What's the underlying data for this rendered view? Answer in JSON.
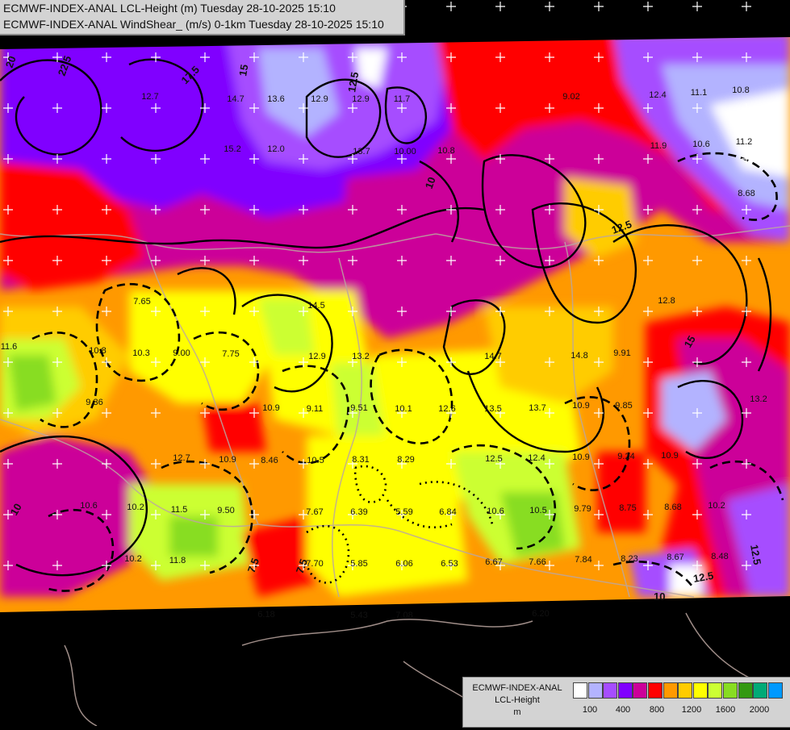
{
  "header": {
    "line1": "ECMWF-INDEX-ANAL LCL-Height (m) Tuesday 28-10-2025 15:10",
    "line2": "ECMWF-INDEX-ANAL WindShear_ (m/s) 0-1km Tuesday 28-10-2025 15:10"
  },
  "legend": {
    "title_line1": "ECMWF-INDEX-ANAL",
    "title_line2": "LCL-Height",
    "unit": "m",
    "colors": [
      "#ffffff",
      "#b3b3ff",
      "#a64dff",
      "#8000ff",
      "#cc0099",
      "#ff0000",
      "#ff9900",
      "#ffcc00",
      "#ffff00",
      "#ccff33",
      "#88dd22",
      "#339911",
      "#00aa77",
      "#0099ff"
    ],
    "ticks": [
      "100",
      "400",
      "800",
      "1200",
      "1600",
      "2000"
    ]
  },
  "map": {
    "value_labels": [
      {
        "t": "12.7"
      },
      {
        "t": "13.6"
      },
      {
        "t": "12.9"
      },
      {
        "t": "12.9"
      },
      {
        "t": "11.7"
      },
      {
        "t": "14.7"
      },
      {
        "t": "9.02"
      },
      {
        "t": "12.4"
      },
      {
        "t": "11.1"
      },
      {
        "t": "10.8"
      },
      {
        "t": "15.2"
      },
      {
        "t": "12.0"
      },
      {
        "t": "13.7"
      },
      {
        "t": "10.00"
      },
      {
        "t": "10.8"
      },
      {
        "t": "11.9"
      },
      {
        "t": "10.6"
      },
      {
        "t": "11.2"
      },
      {
        "t": "8.68"
      },
      {
        "t": "7.65"
      },
      {
        "t": "10.3"
      },
      {
        "t": "9.00"
      },
      {
        "t": "7.75"
      },
      {
        "t": "14.5"
      },
      {
        "t": "12.9"
      },
      {
        "t": "13.2"
      },
      {
        "t": "14.7"
      },
      {
        "t": "14.8"
      },
      {
        "t": "9.91"
      },
      {
        "t": "12.8"
      },
      {
        "t": "11.6"
      },
      {
        "t": "10.8"
      },
      {
        "t": "9.36"
      },
      {
        "t": "10.9"
      },
      {
        "t": "9.11"
      },
      {
        "t": "9.51"
      },
      {
        "t": "10.1"
      },
      {
        "t": "12.6"
      },
      {
        "t": "13.5"
      },
      {
        "t": "13.7"
      },
      {
        "t": "10.9"
      },
      {
        "t": "9.85"
      },
      {
        "t": "13.2"
      },
      {
        "t": "12.7"
      },
      {
        "t": "10.9"
      },
      {
        "t": "8.46"
      },
      {
        "t": "10.5"
      },
      {
        "t": "8.31"
      },
      {
        "t": "8.29"
      },
      {
        "t": "12.5"
      },
      {
        "t": "12.4"
      },
      {
        "t": "10.9"
      },
      {
        "t": "9.24"
      },
      {
        "t": "10.9"
      },
      {
        "t": "10.6"
      },
      {
        "t": "10.2"
      },
      {
        "t": "11.5"
      },
      {
        "t": "9.50"
      },
      {
        "t": "7.67"
      },
      {
        "t": "6.39"
      },
      {
        "t": "5.59"
      },
      {
        "t": "6.84"
      },
      {
        "t": "10.6"
      },
      {
        "t": "10.5"
      },
      {
        "t": "9.79"
      },
      {
        "t": "8.75"
      },
      {
        "t": "8.68"
      },
      {
        "t": "10.2"
      },
      {
        "t": "10.2"
      },
      {
        "t": "11.8"
      },
      {
        "t": "7.70"
      },
      {
        "t": "5.85"
      },
      {
        "t": "6.06"
      },
      {
        "t": "6.53"
      },
      {
        "t": "6.67"
      },
      {
        "t": "7.66"
      },
      {
        "t": "7.84"
      },
      {
        "t": "8.23"
      },
      {
        "t": "8.67"
      },
      {
        "t": "8.48"
      },
      {
        "t": "5.43"
      },
      {
        "t": "7.08"
      },
      {
        "t": "6.20"
      },
      {
        "t": "6.18"
      }
    ],
    "contour_labels": [
      "22.5",
      "20",
      "17.5",
      "15",
      "12.5",
      "10",
      "7.5",
      "12.5",
      "15",
      "10",
      "12.5",
      "10",
      "7.5",
      "12.5"
    ]
  }
}
